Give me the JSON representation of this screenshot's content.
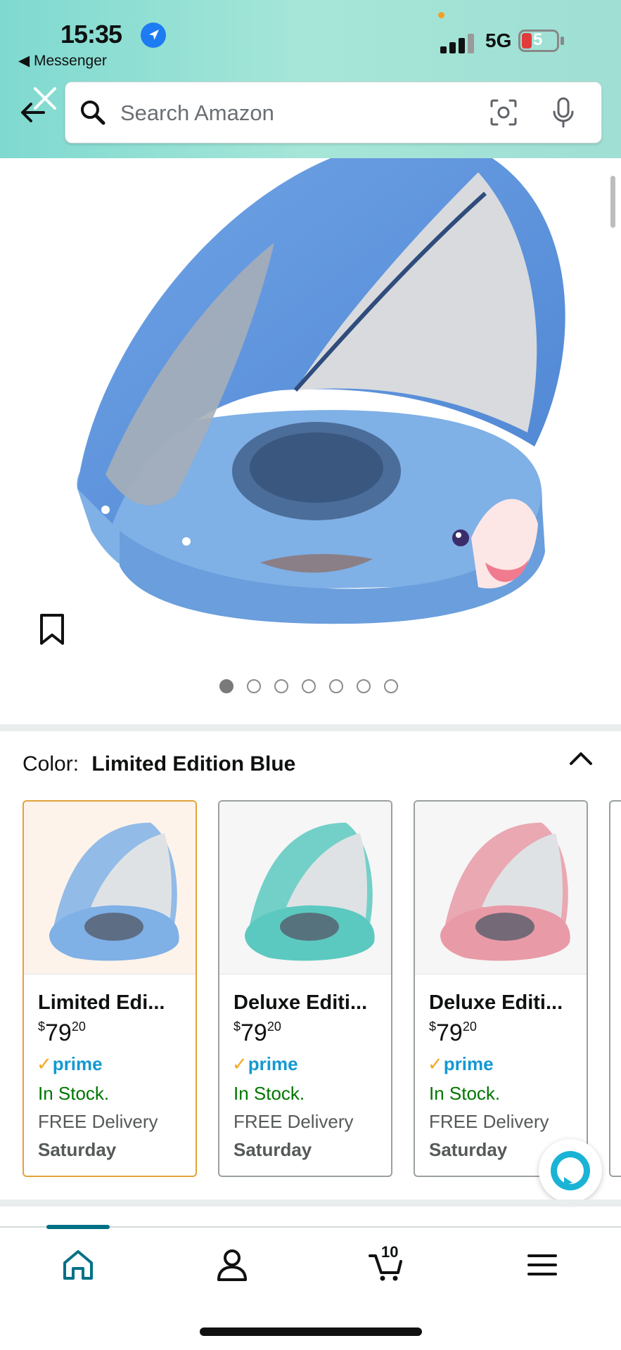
{
  "status_bar": {
    "time": "15:35",
    "back_app": "◀ Messenger",
    "network": "5G",
    "battery": "5"
  },
  "search": {
    "placeholder": "Search Amazon"
  },
  "carousel": {
    "total_images": 7,
    "active_index": 0
  },
  "color_section": {
    "label": "Color:",
    "selected": "Limited Edition Blue"
  },
  "variants": [
    {
      "title": "Limited Edi...",
      "price_symbol": "$",
      "price_whole": "79",
      "price_fraction": "20",
      "prime": "prime",
      "stock": "In Stock.",
      "delivery": "FREE Delivery",
      "day": "Saturday",
      "selected": true,
      "color": "#7fb0e6"
    },
    {
      "title": "Deluxe Editi...",
      "price_symbol": "$",
      "price_whole": "79",
      "price_fraction": "20",
      "prime": "prime",
      "stock": "In Stock.",
      "delivery": "FREE Delivery",
      "day": "Saturday",
      "selected": false,
      "color": "#5cc9c0"
    },
    {
      "title": "Deluxe Editi...",
      "price_symbol": "$",
      "price_whole": "79",
      "price_fraction": "20",
      "prime": "prime",
      "stock": "In Stock.",
      "delivery": "FREE Delivery",
      "day": "Saturday",
      "selected": false,
      "color": "#e89aa6"
    }
  ],
  "bottom_nav": {
    "cart_count": "10",
    "items": [
      "home-icon",
      "account-icon",
      "cart-icon",
      "menu-icon"
    ]
  },
  "colors": {
    "accent": "#007185",
    "prime": "#1399d1",
    "in_stock": "#007600",
    "selected_border": "#e3a23a"
  }
}
